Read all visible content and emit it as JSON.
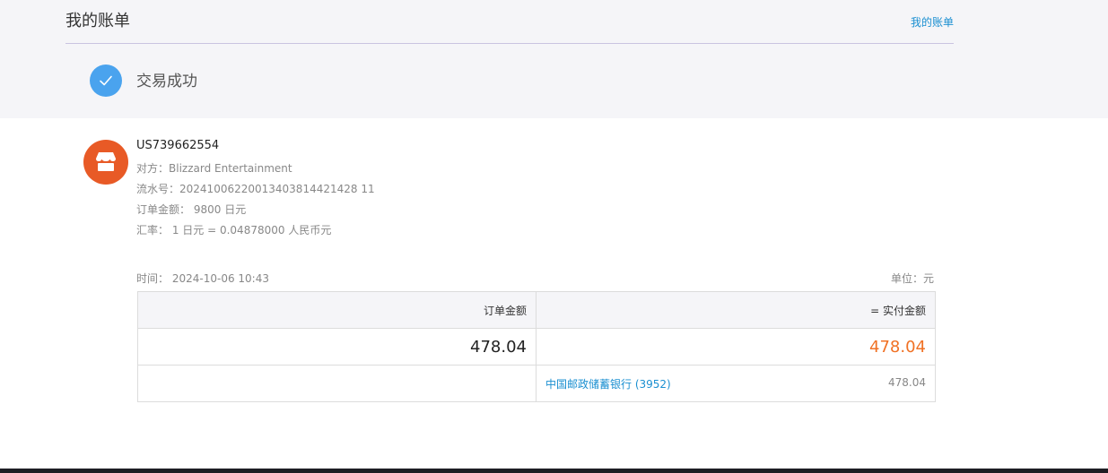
{
  "header": {
    "title": "我的账单",
    "link_label": "我的账单"
  },
  "status": {
    "text": "交易成功",
    "icon": "check-icon",
    "color": "#4aa3ee"
  },
  "transaction": {
    "merchant_icon": "store-icon",
    "merchant_icon_color": "#e85a26",
    "order_id": "US739662554",
    "counterparty_label": "对方：",
    "counterparty_value": "Blizzard Entertainment",
    "serial_label": "流水号：",
    "serial_value": "20241006220013403814421428 11",
    "order_amount_label": "订单金额：",
    "order_amount_value": "9800 日元",
    "rate_label": "汇率：",
    "rate_value": "1 日元 = 0.04878000 人民币元"
  },
  "meta": {
    "time_label": "时间：",
    "time_value": "2024-10-06 10:43",
    "unit_label": "单位：元"
  },
  "table": {
    "col_order_amount": "订单金额",
    "col_paid_amount": "= 实付金额",
    "order_amount": "478.04",
    "paid_amount": "478.04",
    "paid_color": "#f07124",
    "bank_name": "中国邮政储蓄银行 (3952)",
    "bank_amount": "478.04"
  }
}
